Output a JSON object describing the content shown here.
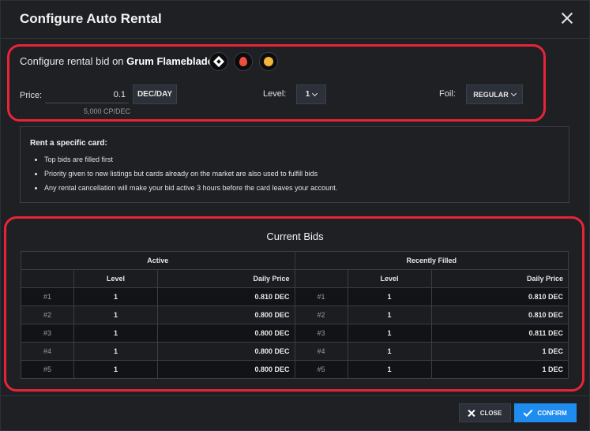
{
  "modal": {
    "title": "Configure Auto Rental"
  },
  "config": {
    "label_prefix": "Configure rental bid on",
    "card_name": "Grum Flameblade",
    "badges": [
      "diamond-icon",
      "fire-element-icon",
      "gold-coin-icon"
    ],
    "price_label": "Price:",
    "price_value": "0.1",
    "price_unit": "DEC/DAY",
    "price_hint": "5,000 CP/DEC",
    "level_label": "Level:",
    "level_value": "1",
    "foil_label": "Foil:",
    "foil_value": "REGULAR"
  },
  "info": {
    "title": "Rent a specific card:",
    "items": [
      "Top bids are filled first",
      "Priority given to new listings but cards already on the market are also used to fulfill bids",
      "Any rental cancellation will make your bid active 3 hours before the card leaves your account."
    ]
  },
  "bids": {
    "title": "Current Bids",
    "active_header": "Active",
    "filled_header": "Recently Filled",
    "col_level": "Level",
    "col_price": "Daily Price",
    "rows": [
      {
        "a_rank": "#1",
        "a_level": "1",
        "a_price": "0.810 DEC",
        "f_rank": "#1",
        "f_level": "1",
        "f_price": "0.810 DEC"
      },
      {
        "a_rank": "#2",
        "a_level": "1",
        "a_price": "0.800 DEC",
        "f_rank": "#2",
        "f_level": "1",
        "f_price": "0.810 DEC"
      },
      {
        "a_rank": "#3",
        "a_level": "1",
        "a_price": "0.800 DEC",
        "f_rank": "#3",
        "f_level": "1",
        "f_price": "0.811 DEC"
      },
      {
        "a_rank": "#4",
        "a_level": "1",
        "a_price": "0.800 DEC",
        "f_rank": "#4",
        "f_level": "1",
        "f_price": "1 DEC"
      },
      {
        "a_rank": "#5",
        "a_level": "1",
        "a_price": "0.800 DEC",
        "f_rank": "#5",
        "f_level": "1",
        "f_price": "1 DEC"
      }
    ]
  },
  "footer": {
    "close_label": "CLOSE",
    "confirm_label": "CONFIRM"
  },
  "colors": {
    "highlight": "#e8243a",
    "primary": "#1f8cf0",
    "background": "#1e2024"
  }
}
